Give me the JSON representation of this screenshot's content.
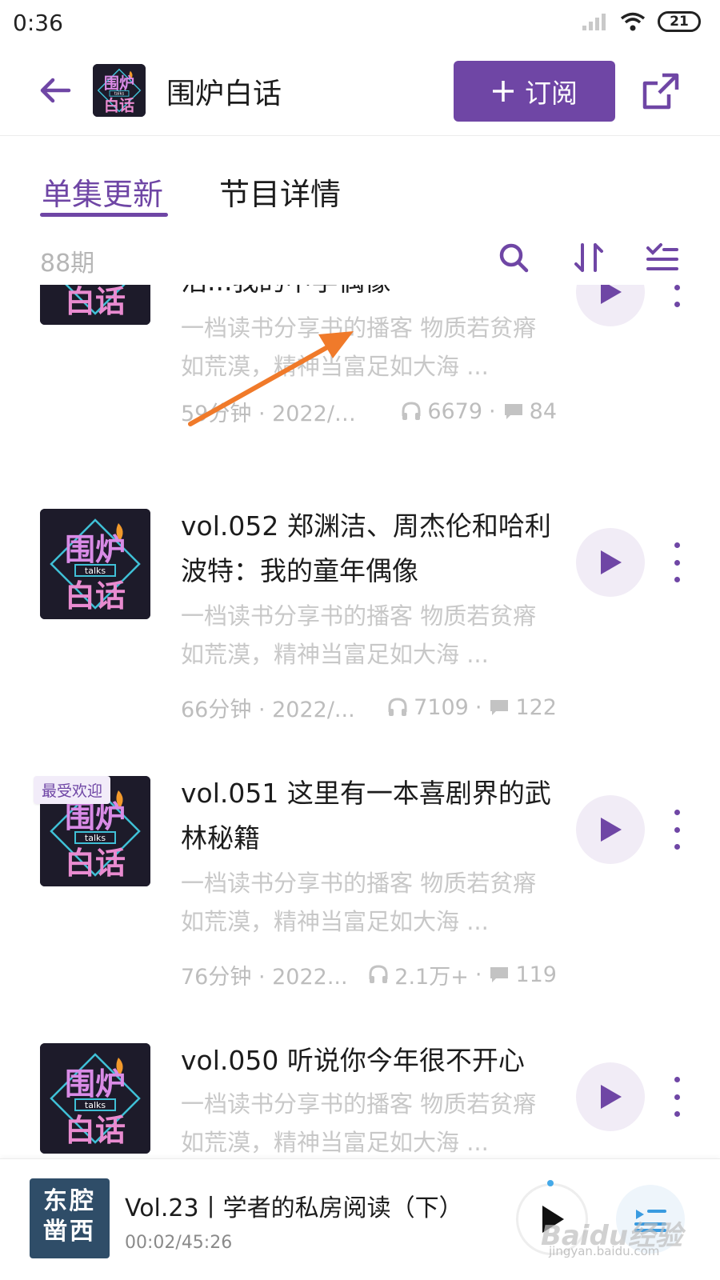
{
  "status_bar": {
    "time": "0:36",
    "battery": "21"
  },
  "header": {
    "title": "围炉白话",
    "subscribe_label": "订阅"
  },
  "tabs": [
    {
      "label": "单集更新",
      "active": true
    },
    {
      "label": "节目详情",
      "active": false
    }
  ],
  "toolbar": {
    "episode_count": "88期"
  },
  "cover_art": {
    "line1": "围炉",
    "small": "talks",
    "line2": "白话"
  },
  "episodes": [
    {
      "title": "浩...我的中学偶像",
      "desc": "一档读书分享书的播客 物质若贫瘠如荒漠，精神当富足如大海 ...",
      "duration": "59分钟 · 2022/1...",
      "plays": "6679",
      "comments": "84"
    },
    {
      "title": "vol.052 郑渊洁、周杰伦和哈利波特：我的童年偶像",
      "desc": "一档读书分享书的播客 物质若贫瘠如荒漠，精神当富足如大海 ...",
      "duration": "66分钟 · 2022/...",
      "plays": "7109",
      "comments": "122"
    },
    {
      "title": "vol.051 这里有一本喜剧界的武林秘籍",
      "badge": "最受欢迎",
      "desc": "一档读书分享书的播客 物质若贫瘠如荒漠，精神当富足如大海 ...",
      "duration": "76分钟 · 2022...",
      "plays": "2.1万+",
      "comments": "119"
    },
    {
      "title": "vol.050 听说你今年很不开心",
      "desc": "一档读书分享书的播客 物质若贫瘠如荒漠，精神当富足如大海 ..."
    }
  ],
  "now_playing": {
    "cover_text_line1": "东腔",
    "cover_text_line2": "凿西",
    "title": "Vol.23丨学者的私房阅读（下）",
    "time": "00:02/45:26"
  },
  "watermark": {
    "brand": "Baidu经验",
    "url": "jingyan.baidu.com"
  },
  "colors": {
    "accent": "#6f46a5",
    "play_bg": "#f1ecf6",
    "muted_text": "#c8c8c8",
    "annotation_arrow": "#f07a2a"
  }
}
